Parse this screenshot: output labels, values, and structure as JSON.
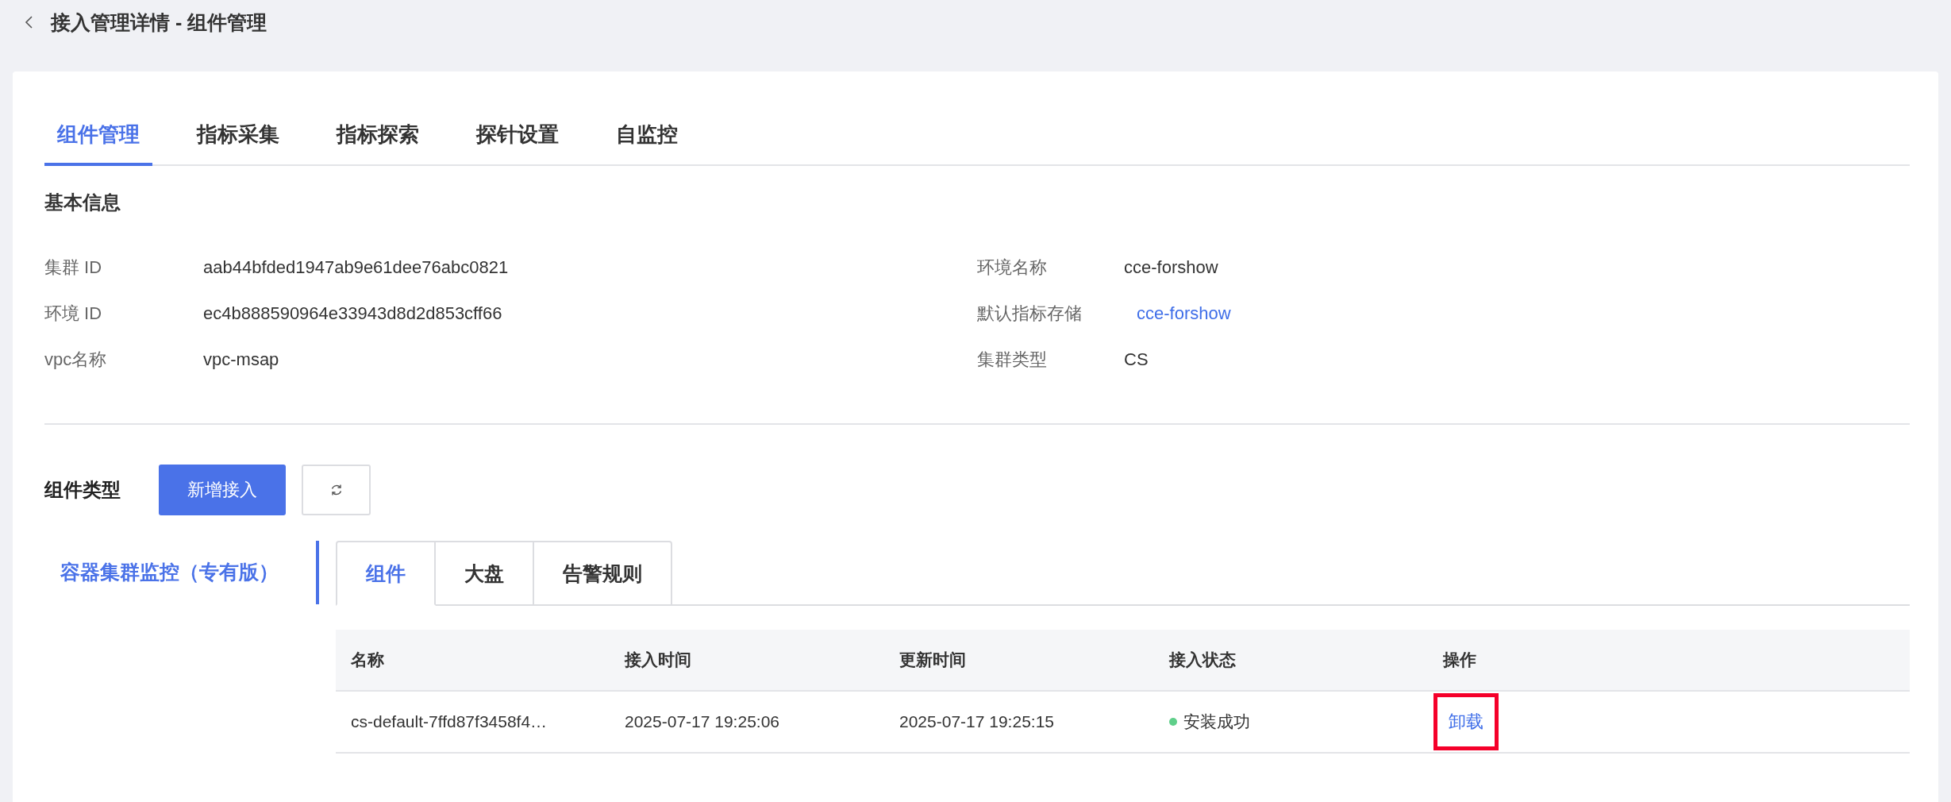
{
  "header": {
    "title": "接入管理详情 - 组件管理"
  },
  "tabs": [
    {
      "label": "组件管理",
      "selected": true
    },
    {
      "label": "指标采集",
      "selected": false
    },
    {
      "label": "指标探索",
      "selected": false
    },
    {
      "label": "探针设置",
      "selected": false
    },
    {
      "label": "自监控",
      "selected": false
    }
  ],
  "basic_info": {
    "title": "基本信息",
    "left": [
      {
        "label": "集群 ID",
        "value": "aab44bfded1947ab9e61dee76abc0821",
        "kind": "text"
      },
      {
        "label": "环境 ID",
        "value": "ec4b888590964e33943d8d2d853cff66",
        "kind": "text"
      },
      {
        "label": "vpc名称",
        "value": "vpc-msap",
        "kind": "text"
      }
    ],
    "right": [
      {
        "label": "环境名称",
        "value": "cce-forshow",
        "kind": "text"
      },
      {
        "label": "默认指标存储",
        "value": "cce-forshow",
        "kind": "link"
      },
      {
        "label": "集群类型",
        "value": "CS",
        "kind": "text"
      }
    ]
  },
  "component_type": {
    "title": "组件类型",
    "add_button": "新增接入"
  },
  "side_tabs": [
    {
      "label": "容器集群监控（专有版）",
      "selected": true
    }
  ],
  "sub_tabs": [
    {
      "label": "组件",
      "selected": true
    },
    {
      "label": "大盘",
      "selected": false
    },
    {
      "label": "告警规则",
      "selected": false
    }
  ],
  "table": {
    "columns": [
      "名称",
      "接入时间",
      "更新时间",
      "接入状态",
      "操作"
    ],
    "rows": [
      {
        "name": "cs-default-7ffd87f3458f4…",
        "access_time": "2025-07-17 19:25:06",
        "update_time": "2025-07-17 19:25:15",
        "status": "安装成功",
        "color": "#5fcf8a",
        "action": "卸载",
        "action_highlighted": true
      }
    ]
  }
}
